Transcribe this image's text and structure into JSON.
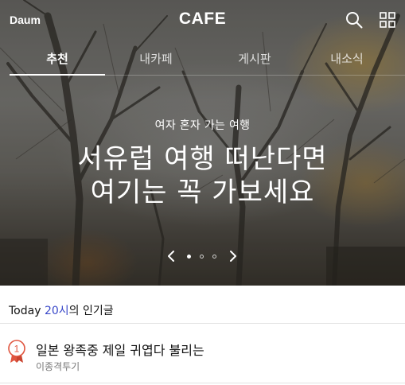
{
  "header": {
    "logo_text": "Daum",
    "title": "CAFE",
    "search_icon": "search-icon",
    "menu_icon": "grid-menu-icon"
  },
  "tabs": [
    {
      "label": "추천",
      "active": true
    },
    {
      "label": "내카페",
      "active": false
    },
    {
      "label": "게시판",
      "active": false
    },
    {
      "label": "내소식",
      "active": false
    }
  ],
  "hero": {
    "subtitle": "여자 혼자 가는 여행",
    "headline_line1": "서유럽 여행 떠난다면",
    "headline_line2": "여기는 꼭 가보세요",
    "slide_count": 3,
    "active_slide": 1
  },
  "today": {
    "prefix": "Today ",
    "hour": "20시",
    "suffix": "의 인기글"
  },
  "popular_posts": [
    {
      "rank": "1",
      "title": "일본 왕족중 제일 귀엽다 불리는",
      "cafe": "이종격투기"
    }
  ],
  "colors": {
    "highlight": "#3a49c9",
    "rank_badge": "#e0553f"
  }
}
